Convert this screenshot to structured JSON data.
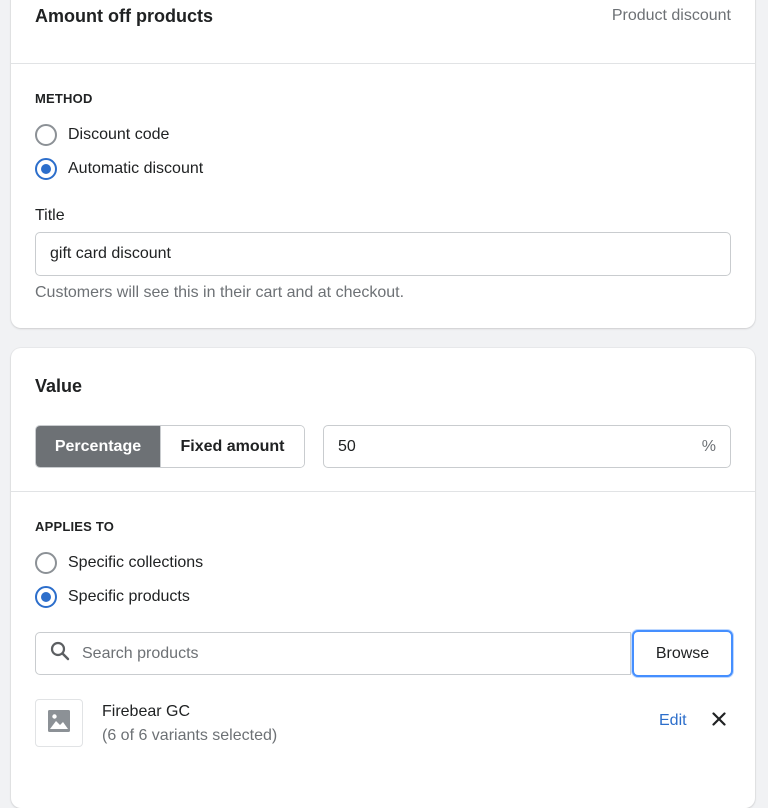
{
  "method_card": {
    "title": "Amount off products",
    "subtitle": "Product discount",
    "method_label": "METHOD",
    "method_options": [
      {
        "label": "Discount code",
        "checked": false
      },
      {
        "label": "Automatic discount",
        "checked": true
      }
    ],
    "title_field_label": "Title",
    "title_field_value": "gift card discount",
    "title_help": "Customers will see this in their cart and at checkout."
  },
  "value_card": {
    "title": "Value",
    "type_options": [
      {
        "label": "Percentage",
        "active": true
      },
      {
        "label": "Fixed amount",
        "active": false
      }
    ],
    "value": "50",
    "value_suffix": "%",
    "applies_to_label": "APPLIES TO",
    "applies_options": [
      {
        "label": "Specific collections",
        "checked": false
      },
      {
        "label": "Specific products",
        "checked": true
      }
    ],
    "search_placeholder": "Search products",
    "browse_label": "Browse",
    "products": [
      {
        "name": "Firebear GC",
        "variants": "(6 of 6 variants selected)",
        "edit_label": "Edit",
        "icon": "image-placeholder-icon"
      }
    ]
  },
  "colors": {
    "accent": "#2c6ecb",
    "focus_ring": "#458fff",
    "segment_active": "#6d7175"
  }
}
